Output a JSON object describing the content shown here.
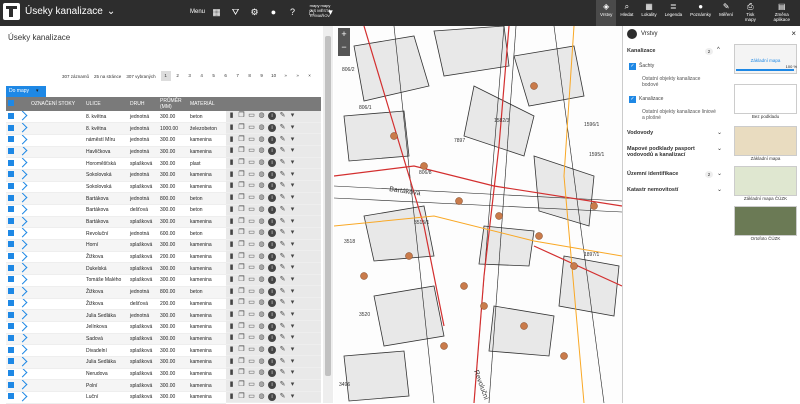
{
  "app": {
    "title": "Úseky kanalizace",
    "menu": "Menu",
    "brand_line1": "mapy mapy",
    "brand_line2": "GIS MĚSTA",
    "brand_line3": "RÝMAŘOV"
  },
  "toolbar_right": [
    {
      "label": "Vrstvy",
      "icon": "layers-icon",
      "glyph": "◈",
      "active": true
    },
    {
      "label": "Hledat",
      "icon": "search-icon",
      "glyph": "⌕",
      "active": false
    },
    {
      "label": "Lokality",
      "icon": "locality-icon",
      "glyph": "▦",
      "active": false
    },
    {
      "label": "Legenda",
      "icon": "legend-icon",
      "glyph": "≣",
      "active": false
    },
    {
      "label": "Poznámky",
      "icon": "pin-icon",
      "glyph": "●",
      "active": false
    },
    {
      "label": "Měření",
      "icon": "ruler-icon",
      "glyph": "✎",
      "active": false
    },
    {
      "label": "Tisk mapy",
      "icon": "print-icon",
      "glyph": "⎙",
      "active": false
    },
    {
      "label": "Změna aplikace",
      "icon": "apps-icon",
      "glyph": "▤",
      "active": false
    }
  ],
  "panel": {
    "title": "Úseky kanalizace",
    "pager": {
      "records": "307 záznamů",
      "per_page": "25 na stránce",
      "selected": "307 vybraných",
      "pages": [
        "1",
        "2",
        "3",
        "4",
        "5",
        "6",
        "7",
        "8",
        "9",
        "10",
        "»",
        "»",
        "×"
      ],
      "current": "1"
    },
    "do_mapy": "Do mapy",
    "columns": [
      "OZNAČENÍ STOKY",
      "ULICE",
      "DRUH",
      "PRŮMĚR (MM)",
      "MATERIÁL"
    ],
    "rows": [
      [
        "8. května",
        "jednotná",
        "300.00",
        "beton"
      ],
      [
        "8. května",
        "jednotná",
        "1000.00",
        "železobeton"
      ],
      [
        "náměstí Míru",
        "jednotná",
        "300.00",
        "kamenina"
      ],
      [
        "Havlíčkova",
        "jednotná",
        "300.00",
        "kamenina"
      ],
      [
        "Horoměšťská",
        "splašková",
        "300.00",
        "plast"
      ],
      [
        "Sokolovská",
        "jednotná",
        "300.00",
        "kamenina"
      ],
      [
        "Sokolovská",
        "splašková",
        "300.00",
        "kamenina"
      ],
      [
        "Bartákova",
        "jednotná",
        "800.00",
        "beton"
      ],
      [
        "Bartákova",
        "dešťová",
        "300.00",
        "beton"
      ],
      [
        "Bartákova",
        "splašková",
        "300.00",
        "kamenina"
      ],
      [
        "Revoluční",
        "jednotná",
        "600.00",
        "beton"
      ],
      [
        "Horní",
        "splašková",
        "300.00",
        "kamenina"
      ],
      [
        "Žižkova",
        "splašková",
        "200.00",
        "kamenina"
      ],
      [
        "Dukelská",
        "splašková",
        "300.00",
        "kamenina"
      ],
      [
        "Tomáše Malého",
        "splašková",
        "300.00",
        "kamenina"
      ],
      [
        "Žižkova",
        "jednotná",
        "800.00",
        "beton"
      ],
      [
        "Žižkova",
        "dešťová",
        "200.00",
        "kamenina"
      ],
      [
        "Julia Sedláka",
        "jednotná",
        "300.00",
        "kamenina"
      ],
      [
        "Jelínkova",
        "splašková",
        "300.00",
        "kamenina"
      ],
      [
        "Sadová",
        "splašková",
        "300.00",
        "kamenina"
      ],
      [
        "Divadelní",
        "splašková",
        "300.00",
        "kamenina"
      ],
      [
        "Julia Sedláka",
        "splašková",
        "300.00",
        "kamenina"
      ],
      [
        "Nerudova",
        "splašková",
        "300.00",
        "kamenina"
      ],
      [
        "Polní",
        "splašková",
        "300.00",
        "kamenina"
      ],
      [
        "Luční",
        "splašková",
        "300.00",
        "kamenina"
      ]
    ]
  },
  "map": {
    "streets": [
      "Bartákova",
      "Revoluční"
    ],
    "parcels": [
      "806/2",
      "806/1",
      "7897",
      "806/8",
      "1582/3",
      "1595/1",
      "3515/1",
      "3518",
      "3520",
      "3496",
      "1596/1",
      "1897/1"
    ]
  },
  "layers": {
    "title": "Vrstvy",
    "kanalizace": {
      "label": "Kanalizace",
      "count": "2"
    },
    "items": [
      "Šachty",
      "Kanalizace"
    ],
    "sub1": "Ostatní objekty kanalizace bodové",
    "sub2": "Ostatní objekty kanalizace liniové a plošné",
    "sections": [
      "Vodovody",
      "Mapové podklady pasport vodovodů a kanalizací",
      "Územní identifikace",
      "Katastr nemovitostí"
    ],
    "section_counts": [
      "",
      "",
      "2",
      ""
    ],
    "bases": [
      "Základní mapa",
      "Bez podkladu",
      "Základní mapa",
      "Základní mapa ČÚZK",
      "Ortofoto ČÚZK"
    ],
    "opacity": "100 %",
    "accent": "#1e88e5"
  }
}
